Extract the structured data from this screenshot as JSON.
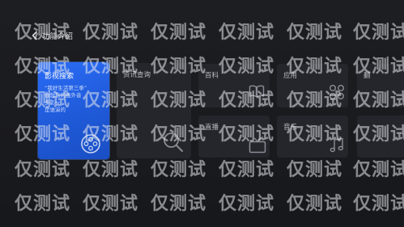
{
  "header": {
    "back_icon": "chevron-left-icon",
    "title": "功能介绍"
  },
  "cards": {
    "featured": {
      "label": "影视搜索",
      "desc_lines": [
        "“我好生活第三季”",
        "你想看的画外音",
        "多影一",
        "是谁演的"
      ],
      "icon": "film-reel-icon"
    },
    "info": {
      "label": "资讯查询",
      "icon": "search-icon"
    },
    "baike": {
      "label": "百科",
      "icon": "book-icon"
    },
    "app": {
      "label": "应用",
      "icon": "apps-grid-icon"
    },
    "live": {
      "label": "直播",
      "icon": "tv-icon"
    },
    "music": {
      "label": "音乐",
      "icon": "music-note-icon"
    },
    "edge_top": {
      "label": "翻"
    }
  },
  "watermark": {
    "text": "仅测试"
  },
  "colors": {
    "background": "#1a1b1f",
    "card": "#25262b",
    "accent": "#2a6cf6"
  }
}
